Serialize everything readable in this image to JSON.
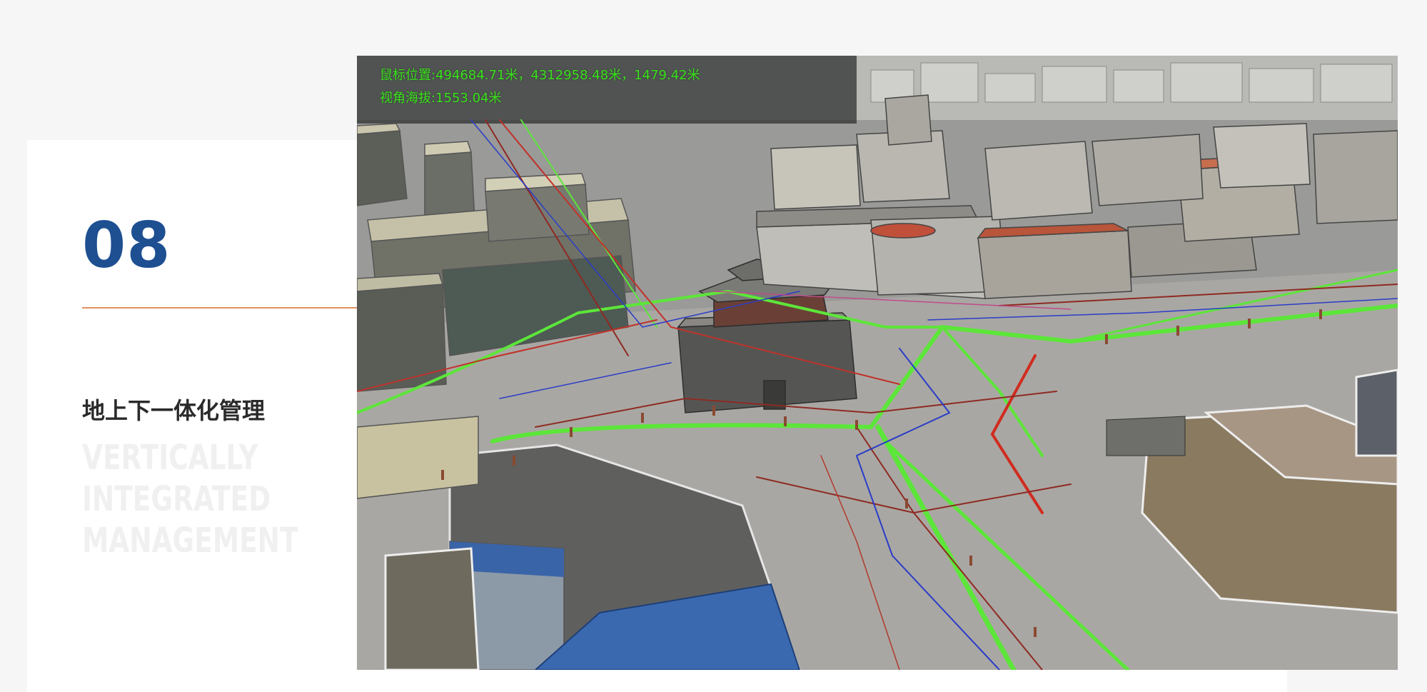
{
  "section": {
    "number": "08",
    "title_cn": "地上下一体化管理",
    "title_en_lines": [
      "VERTICALLY",
      "INTEGRATED",
      "MANAGEMENT"
    ]
  },
  "viewer": {
    "mouse_position": "鼠标位置:494684.71米，4312958.48米，1479.42米",
    "camera_altitude": "视角海拔:1553.04米"
  },
  "colors": {
    "accent_blue": "#1d4f91",
    "divider_orange": "#e0915f",
    "hud_green": "#39e21a",
    "pipe_green": "#5de63a",
    "pipe_red": "#c0322a",
    "pipe_blue": "#2a3cc8"
  }
}
